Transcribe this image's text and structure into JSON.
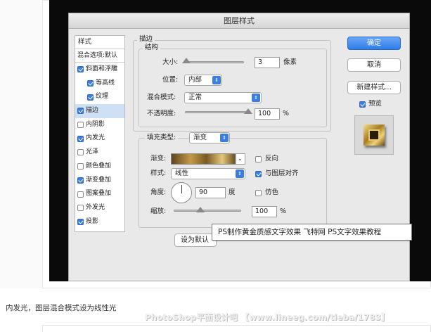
{
  "dialog": {
    "title": "图层样式",
    "styles_header": "样式",
    "blend_options": "混合选项:默认",
    "effects": [
      {
        "label": "斜面和浮雕",
        "checked": true,
        "indent": false,
        "selected": false
      },
      {
        "label": "等高线",
        "checked": true,
        "indent": true,
        "selected": false
      },
      {
        "label": "纹理",
        "checked": true,
        "indent": true,
        "selected": false
      },
      {
        "label": "描边",
        "checked": true,
        "indent": false,
        "selected": true
      },
      {
        "label": "内阴影",
        "checked": false,
        "indent": false,
        "selected": false
      },
      {
        "label": "内发光",
        "checked": true,
        "indent": false,
        "selected": false
      },
      {
        "label": "光泽",
        "checked": false,
        "indent": false,
        "selected": false
      },
      {
        "label": "颜色叠加",
        "checked": false,
        "indent": false,
        "selected": false
      },
      {
        "label": "渐变叠加",
        "checked": true,
        "indent": false,
        "selected": false
      },
      {
        "label": "图案叠加",
        "checked": false,
        "indent": false,
        "selected": false
      },
      {
        "label": "外发光",
        "checked": false,
        "indent": false,
        "selected": false
      },
      {
        "label": "投影",
        "checked": true,
        "indent": false,
        "selected": false
      }
    ],
    "stroke": {
      "group_title": "描边",
      "structure_title": "结构",
      "size_label": "大小:",
      "size_value": "3",
      "size_unit": "像素",
      "position_label": "位置:",
      "position_value": "内部",
      "blend_label": "混合模式:",
      "blend_value": "正常",
      "opacity_label": "不透明度:",
      "opacity_value": "100",
      "opacity_unit": "%",
      "opacity_level": 1.0,
      "size_level": 0.02
    },
    "fill": {
      "fill_type_label": "填充类型:",
      "fill_type_value": "渐变",
      "gradient_label": "渐变:",
      "reverse_label": "反向",
      "reverse_checked": false,
      "style_label": "样式:",
      "style_value": "线性",
      "align_label": "与图层对齐",
      "align_checked": true,
      "angle_label": "角度:",
      "angle_value": "90",
      "angle_unit": "度",
      "dither_label": "仿色",
      "dither_checked": false,
      "scale_label": "缩放:",
      "scale_value": "100",
      "scale_unit": "%",
      "scale_level": 0.4
    },
    "buttons": {
      "ok": "确定",
      "cancel": "取消",
      "new_style": "新建样式...",
      "preview_label": "预览",
      "preview_checked": true,
      "set_default": "设为默认"
    }
  },
  "tooltip": "PS制作黄金质感文字效果 飞特网 PS文字效果教程",
  "caption": "内发光，图层混合模式设为线性光",
  "watermark": "PhotoShop平面设计吧 【www.lineeg.com/tieba/1783】",
  "colors": {
    "accent": "#3b7ee0",
    "selected_row": "#cfe0f5"
  }
}
